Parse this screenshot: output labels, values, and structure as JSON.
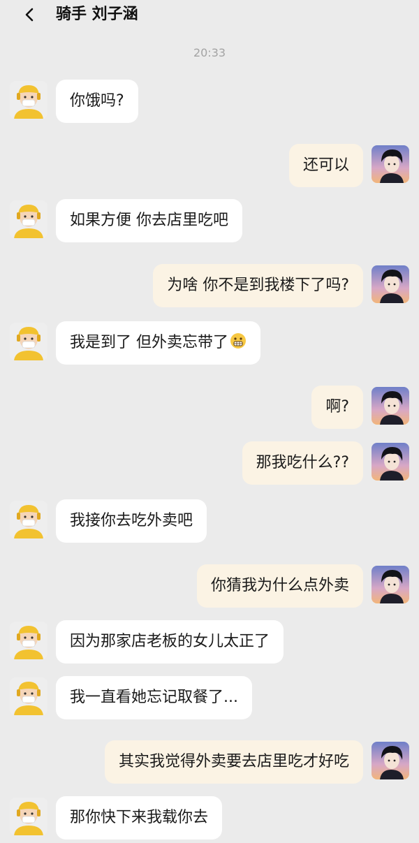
{
  "header": {
    "title": "骑手 刘子涵",
    "back_icon": "chevron-left-icon"
  },
  "time": "20:33",
  "messages": [
    {
      "side": "left",
      "text": "你饿吗?"
    },
    {
      "side": "right",
      "text": "还可以"
    },
    {
      "side": "left",
      "text": "如果方便 你去店里吃吧"
    },
    {
      "side": "right",
      "text": "为啥 你不是到我楼下了吗?"
    },
    {
      "side": "left",
      "text": "我是到了 但外卖忘带了",
      "emoji": "grimace-emoji-icon"
    },
    {
      "side": "right",
      "text": "啊?"
    },
    {
      "side": "right",
      "text": "那我吃什么??"
    },
    {
      "side": "left",
      "text": "我接你去吃外卖吧"
    },
    {
      "side": "right",
      "text": "你猜我为什么点外卖"
    },
    {
      "side": "left",
      "text": "因为那家店老板的女儿太正了"
    },
    {
      "side": "left",
      "text": "我一直看她忘记取餐了..."
    },
    {
      "side": "right",
      "text": "其实我觉得外卖要去店里吃才好吃"
    },
    {
      "side": "left",
      "text": "那你快下来我载你去"
    }
  ],
  "colors": {
    "background": "#ebebeb",
    "bubble_left": "#ffffff",
    "bubble_right": "#fbf3e4",
    "rider_yellow": "#f2c230"
  },
  "avatars": {
    "rider": "rider-avatar-icon",
    "user": "anime-user-avatar-icon"
  }
}
